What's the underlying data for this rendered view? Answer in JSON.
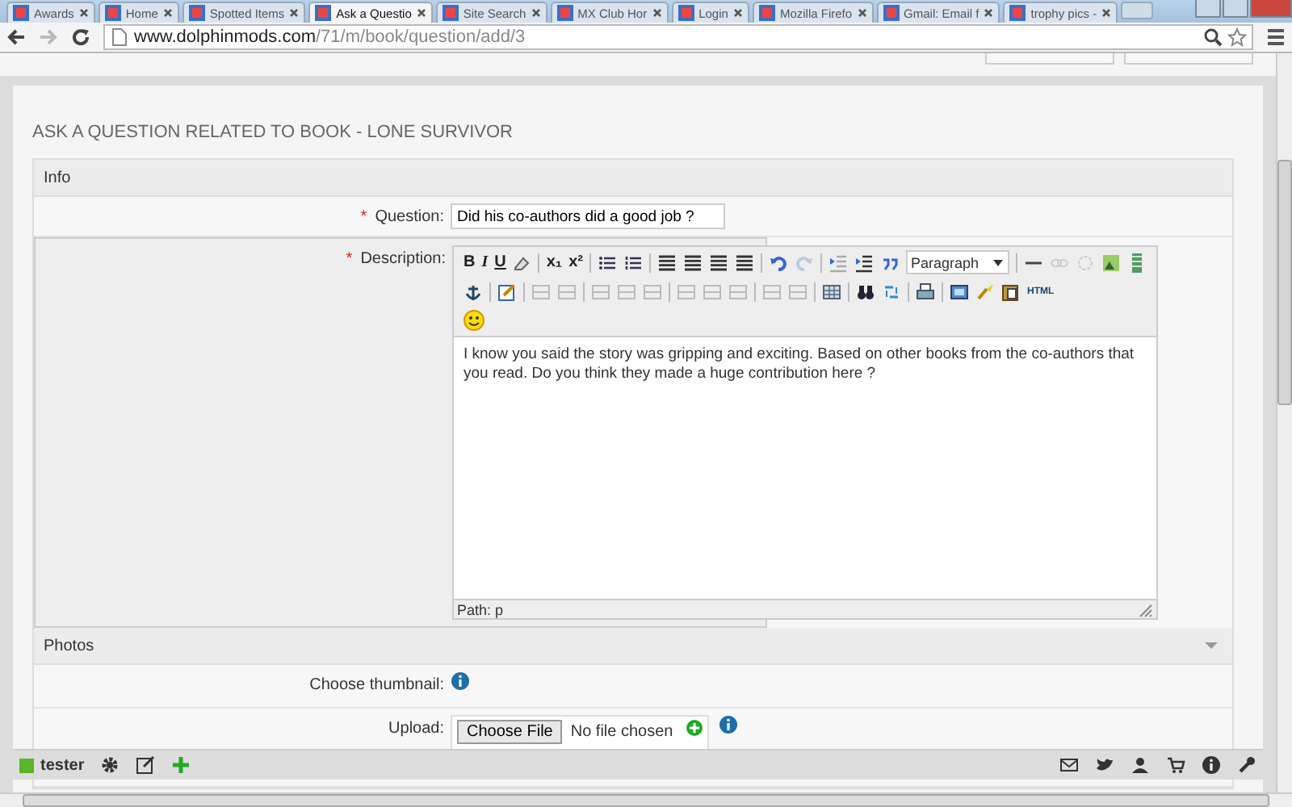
{
  "browser": {
    "tabs": [
      {
        "label": "Awards",
        "selected": false
      },
      {
        "label": "Home",
        "selected": false
      },
      {
        "label": "Spotted Items",
        "selected": false
      },
      {
        "label": "Ask a Questio",
        "selected": true
      },
      {
        "label": "Site Search",
        "selected": false
      },
      {
        "label": "MX Club Hor",
        "selected": false
      },
      {
        "label": "Login",
        "selected": false
      },
      {
        "label": "Mozilla Firefo",
        "selected": false
      },
      {
        "label": "Gmail: Email f",
        "selected": false
      },
      {
        "label": "trophy pics -",
        "selected": false
      }
    ],
    "url_host": "www.dolphinmods.com",
    "url_path": "/71/m/book/question/add/3"
  },
  "page": {
    "title": "ASK A QUESTION RELATED TO BOOK - LONE SURVIVOR",
    "sections": [
      {
        "kind": "header",
        "label": "Info"
      },
      {
        "kind": "text",
        "label": "Question:",
        "required": true,
        "required_mark": "*",
        "value": "Did his co-authors did a good job ?"
      },
      {
        "kind": "editor",
        "label": "Description:",
        "required": true,
        "required_mark": "*",
        "bold": "B",
        "italic": "I",
        "underline": "U",
        "subscript": "x₁",
        "superscript": "x²",
        "format": "Paragraph",
        "html": "HTML",
        "value": "I know you said the story was gripping and exciting. Based on other books from the co-authors that you read. Do you think they made a huge contribution here ?",
        "path": "Path: p"
      },
      {
        "kind": "header",
        "label": "Photos"
      },
      {
        "kind": "info",
        "label": "Choose thumbnail:",
        "required": false
      },
      {
        "kind": "upload",
        "label": "Upload:",
        "required": false,
        "button": "Choose File",
        "status": "No file chosen"
      }
    ]
  },
  "dock": {
    "user": "tester"
  }
}
